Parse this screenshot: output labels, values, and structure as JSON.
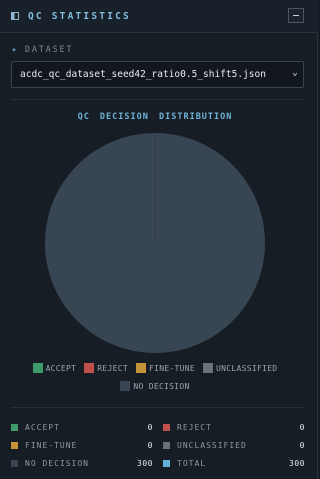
{
  "header": {
    "title": "QC STATISTICS",
    "panel_icon": "panel-icon",
    "collapse_icon": "minimize-icon"
  },
  "dataset": {
    "label": "DATASET",
    "selected": "acdc_qc_dataset_seed42_ratio0.5_shift5.json"
  },
  "colors": {
    "accept": "#3e9a6a",
    "reject": "#c0504a",
    "fine_tune": "#c4933a",
    "unclassified": "#6b7178",
    "no_decision": "#384552",
    "total": "#64b2dc"
  },
  "chart_data": {
    "type": "pie",
    "title": "QC DECISION DISTRIBUTION",
    "slices": [
      {
        "name": "ACCEPT",
        "value": 0,
        "color": "#3e9a6a"
      },
      {
        "name": "REJECT",
        "value": 0,
        "color": "#c0504a"
      },
      {
        "name": "FINE-TUNE",
        "value": 0,
        "color": "#c4933a"
      },
      {
        "name": "UNCLASSIFIED",
        "value": 0,
        "color": "#6b7178"
      },
      {
        "name": "NO DECISION",
        "value": 300,
        "color": "#384552"
      }
    ],
    "legend_position": "bottom"
  },
  "stats": {
    "accept": {
      "label": "ACCEPT",
      "value": "0"
    },
    "reject": {
      "label": "REJECT",
      "value": "0"
    },
    "fine_tune": {
      "label": "FINE-TUNE",
      "value": "0"
    },
    "unclassified": {
      "label": "UNCLASSIFIED",
      "value": "0"
    },
    "no_decision": {
      "label": "NO DECISION",
      "value": "300"
    },
    "total": {
      "label": "TOTAL",
      "value": "300"
    }
  }
}
